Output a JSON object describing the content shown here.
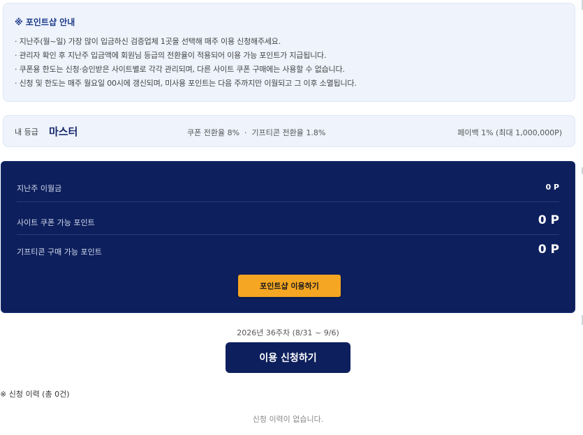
{
  "notice": {
    "title": "※ 포인트샵 안내",
    "lines": [
      "· 지난주(월~일) 가장 많이 입금하신 검증업체 1곳을 선택해 매주 이용 신청해주세요.",
      "· 관리자 확인 후 지난주 입금액에 회원님 등급의 전환율이 적용되어 이용 가능 포인트가 지급됩니다.",
      "· 쿠폰용 한도는 신청·승인받은 사이트별로 각각 관리되며, 다른 사이트 쿠폰 구매에는 사용할 수 없습니다.",
      "· 신청 및 한도는 매주 월요일 00시에 갱신되며, 미사용 포인트는 다음 주까지만 이월되고 그 이후 소멸됩니다."
    ]
  },
  "grade": {
    "label": "내 등급",
    "value": "마스터",
    "rates": "쿠폰 전환율 8%  ·  기프티콘 전환율 1.8%",
    "payback": "페이백 1% (최대 1,000,000P)"
  },
  "points": {
    "rows": [
      {
        "label": "지난주 이월금",
        "value": "0 P"
      },
      {
        "label": "사이트 쿠폰 가능 포인트",
        "value": "0 P"
      },
      {
        "label": "기프티콘 구매 가능 포인트",
        "value": "0 P"
      }
    ],
    "shop_button": "포인트샵 이용하기"
  },
  "apply": {
    "week": "2026년 36주차 (8/31 ~ 9/6)",
    "button": "이용 신청하기"
  },
  "history": {
    "title": "※ 신청 이력 (총 0건)",
    "empty": "신청 이력이 없습니다."
  },
  "colors": {
    "navy": "#0d1f5c",
    "accent": "#f5a623",
    "panel": "#eef3fc"
  }
}
